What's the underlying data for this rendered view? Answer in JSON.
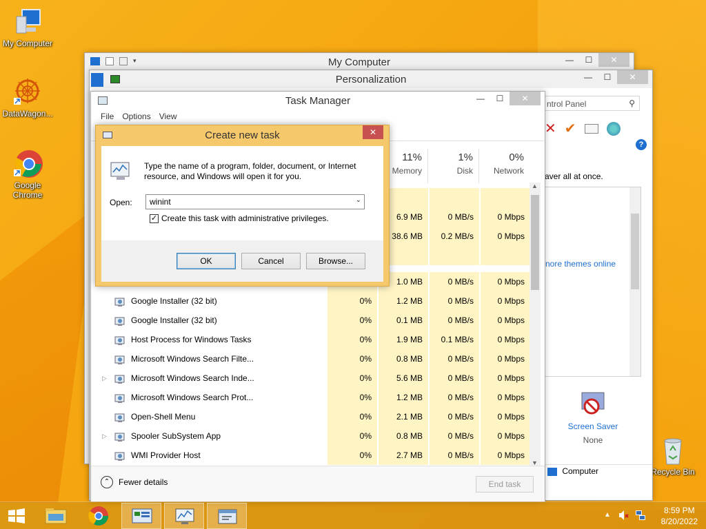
{
  "desktop": {
    "icons": [
      {
        "label": "My Computer"
      },
      {
        "label": "DataWagon..."
      },
      {
        "label": "Google Chrome"
      },
      {
        "label": "Recycle Bin"
      }
    ]
  },
  "my_computer_window": {
    "title": "My Computer"
  },
  "personalization_window": {
    "title": "Personalization",
    "search_placeholder": "ntrol Panel",
    "snippet_text": "aver all at once.",
    "link_text": "nore themes online",
    "screen_saver_label": "Screen Saver",
    "screen_saver_value": "None",
    "footer_item": "Computer"
  },
  "task_manager": {
    "title": "Task Manager",
    "menu": [
      "File",
      "Options",
      "View"
    ],
    "columns": [
      {
        "pct": "11%",
        "label": "Memory"
      },
      {
        "pct": "1%",
        "label": "Disk"
      },
      {
        "pct": "0%",
        "label": "Network"
      }
    ],
    "partial_rows": [
      {
        "mem": "6.9 MB",
        "disk": "0 MB/s",
        "net": "0 Mbps"
      },
      {
        "mem": "38.6 MB",
        "disk": "0.2 MB/s",
        "net": "0 Mbps"
      },
      {
        "mem": "1.0 MB",
        "disk": "0 MB/s",
        "net": "0 Mbps"
      }
    ],
    "rows": [
      {
        "name": "Google Installer (32 bit)",
        "cpu": "0%",
        "mem": "1.2 MB",
        "disk": "0 MB/s",
        "net": "0 Mbps",
        "expand": ""
      },
      {
        "name": "Google Installer (32 bit)",
        "cpu": "0%",
        "mem": "0.1 MB",
        "disk": "0 MB/s",
        "net": "0 Mbps",
        "expand": ""
      },
      {
        "name": "Host Process for Windows Tasks",
        "cpu": "0%",
        "mem": "1.9 MB",
        "disk": "0.1 MB/s",
        "net": "0 Mbps",
        "expand": ""
      },
      {
        "name": "Microsoft Windows Search Filte...",
        "cpu": "0%",
        "mem": "0.8 MB",
        "disk": "0 MB/s",
        "net": "0 Mbps",
        "expand": ""
      },
      {
        "name": "Microsoft Windows Search Inde...",
        "cpu": "0%",
        "mem": "5.6 MB",
        "disk": "0 MB/s",
        "net": "0 Mbps",
        "expand": "▷"
      },
      {
        "name": "Microsoft Windows Search Prot...",
        "cpu": "0%",
        "mem": "1.2 MB",
        "disk": "0 MB/s",
        "net": "0 Mbps",
        "expand": ""
      },
      {
        "name": "Open-Shell Menu",
        "cpu": "0%",
        "mem": "2.1 MB",
        "disk": "0 MB/s",
        "net": "0 Mbps",
        "expand": ""
      },
      {
        "name": "Spooler SubSystem App",
        "cpu": "0%",
        "mem": "0.8 MB",
        "disk": "0 MB/s",
        "net": "0 Mbps",
        "expand": "▷"
      },
      {
        "name": "WMI Provider Host",
        "cpu": "0%",
        "mem": "2.7 MB",
        "disk": "0 MB/s",
        "net": "0 Mbps",
        "expand": ""
      }
    ],
    "fewer_details": "Fewer details",
    "end_task": "End task"
  },
  "dialog": {
    "title": "Create new task",
    "description": "Type the name of a program, folder, document, or Internet resource, and Windows will open it for you.",
    "open_label": "Open:",
    "open_value": "winint",
    "admin_checkbox_label": "Create this task with administrative privileges.",
    "admin_checked": true,
    "ok": "OK",
    "cancel": "Cancel",
    "browse": "Browse..."
  },
  "taskbar": {
    "time": "8:59 PM",
    "date": "8/20/2022"
  },
  "colors": {
    "desktop": "#f5a50f",
    "dialog_frame": "#f5c86c",
    "close_red": "#c75050",
    "cell_highlight": "#fff4c4"
  }
}
